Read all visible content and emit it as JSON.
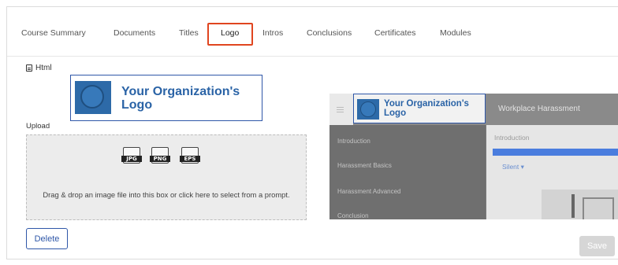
{
  "tabs": [
    {
      "label": "Course Summary"
    },
    {
      "label": "Documents"
    },
    {
      "label": "Titles"
    },
    {
      "label": "Logo"
    },
    {
      "label": "Intros"
    },
    {
      "label": "Conclusions"
    },
    {
      "label": "Certificates"
    },
    {
      "label": "Modules"
    }
  ],
  "active_tab": "Logo",
  "html_label": "Html",
  "logo_preview": {
    "text": "Your Organization's Logo"
  },
  "upload": {
    "label": "Upload",
    "file_types": [
      "JPG",
      "PNG",
      "EPS"
    ],
    "drop_text": "Drag & drop an image file into this box or click here to select from a prompt."
  },
  "buttons": {
    "delete": "Delete",
    "save": "Save"
  },
  "course_preview": {
    "logo_text": "Your Organization's Logo",
    "course_title": "Workplace Harassment",
    "sidebar_items": [
      "Introduction",
      "Harassment Basics",
      "Harassment Advanced",
      "Conclusion"
    ],
    "content_heading": "Introduction",
    "silent_label": "Silent ▾"
  },
  "colors": {
    "accent": "#2f57a8",
    "highlight": "#e0451f",
    "logo_blue": "#2a63a6"
  }
}
